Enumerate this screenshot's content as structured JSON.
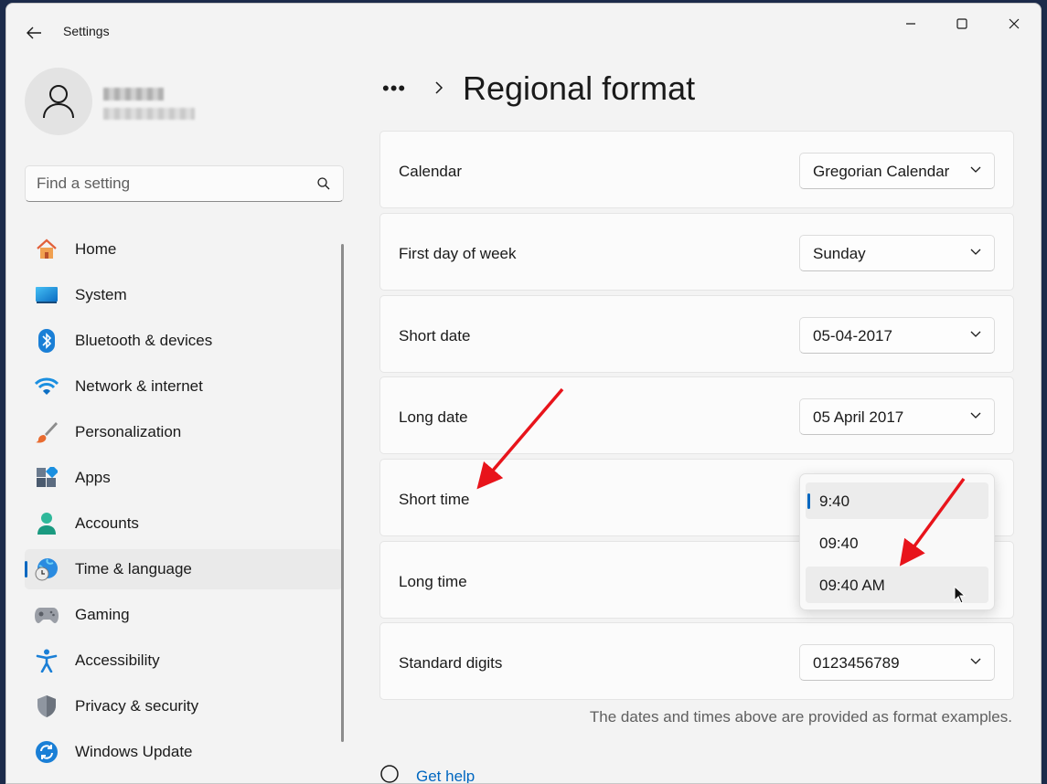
{
  "window": {
    "title": "Settings",
    "minimize_icon": "minimize-icon",
    "maximize_icon": "maximize-icon",
    "close_icon": "close-icon"
  },
  "search": {
    "placeholder": "Find a setting"
  },
  "sidebar": {
    "items": [
      {
        "label": "Home",
        "icon": "home-icon"
      },
      {
        "label": "System",
        "icon": "system-icon"
      },
      {
        "label": "Bluetooth & devices",
        "icon": "bluetooth-icon"
      },
      {
        "label": "Network & internet",
        "icon": "wifi-icon"
      },
      {
        "label": "Personalization",
        "icon": "brush-icon"
      },
      {
        "label": "Apps",
        "icon": "apps-icon"
      },
      {
        "label": "Accounts",
        "icon": "accounts-icon"
      },
      {
        "label": "Time & language",
        "icon": "time-language-icon",
        "active": true
      },
      {
        "label": "Gaming",
        "icon": "gamepad-icon"
      },
      {
        "label": "Accessibility",
        "icon": "accessibility-icon"
      },
      {
        "label": "Privacy & security",
        "icon": "shield-icon"
      },
      {
        "label": "Windows Update",
        "icon": "update-icon"
      }
    ]
  },
  "header": {
    "breadcrumb_overflow": "•••",
    "title": "Regional format"
  },
  "settings": [
    {
      "label": "Calendar",
      "value": "Gregorian Calendar"
    },
    {
      "label": "First day of week",
      "value": "Sunday"
    },
    {
      "label": "Short date",
      "value": "05-04-2017"
    },
    {
      "label": "Long date",
      "value": "05 April 2017"
    },
    {
      "label": "Short time",
      "value": "9:40",
      "expanded": true
    },
    {
      "label": "Long time",
      "value": ""
    },
    {
      "label": "Standard digits",
      "value": "0123456789"
    }
  ],
  "short_time_options": [
    {
      "label": "9:40",
      "selected": true
    },
    {
      "label": "09:40"
    },
    {
      "label": "09:40 AM",
      "hover": true
    }
  ],
  "footnote": "The dates and times above are provided as format examples.",
  "help": {
    "label": "Get help"
  },
  "colors": {
    "accent": "#0067c0",
    "annotation_arrow": "#e8141b"
  }
}
